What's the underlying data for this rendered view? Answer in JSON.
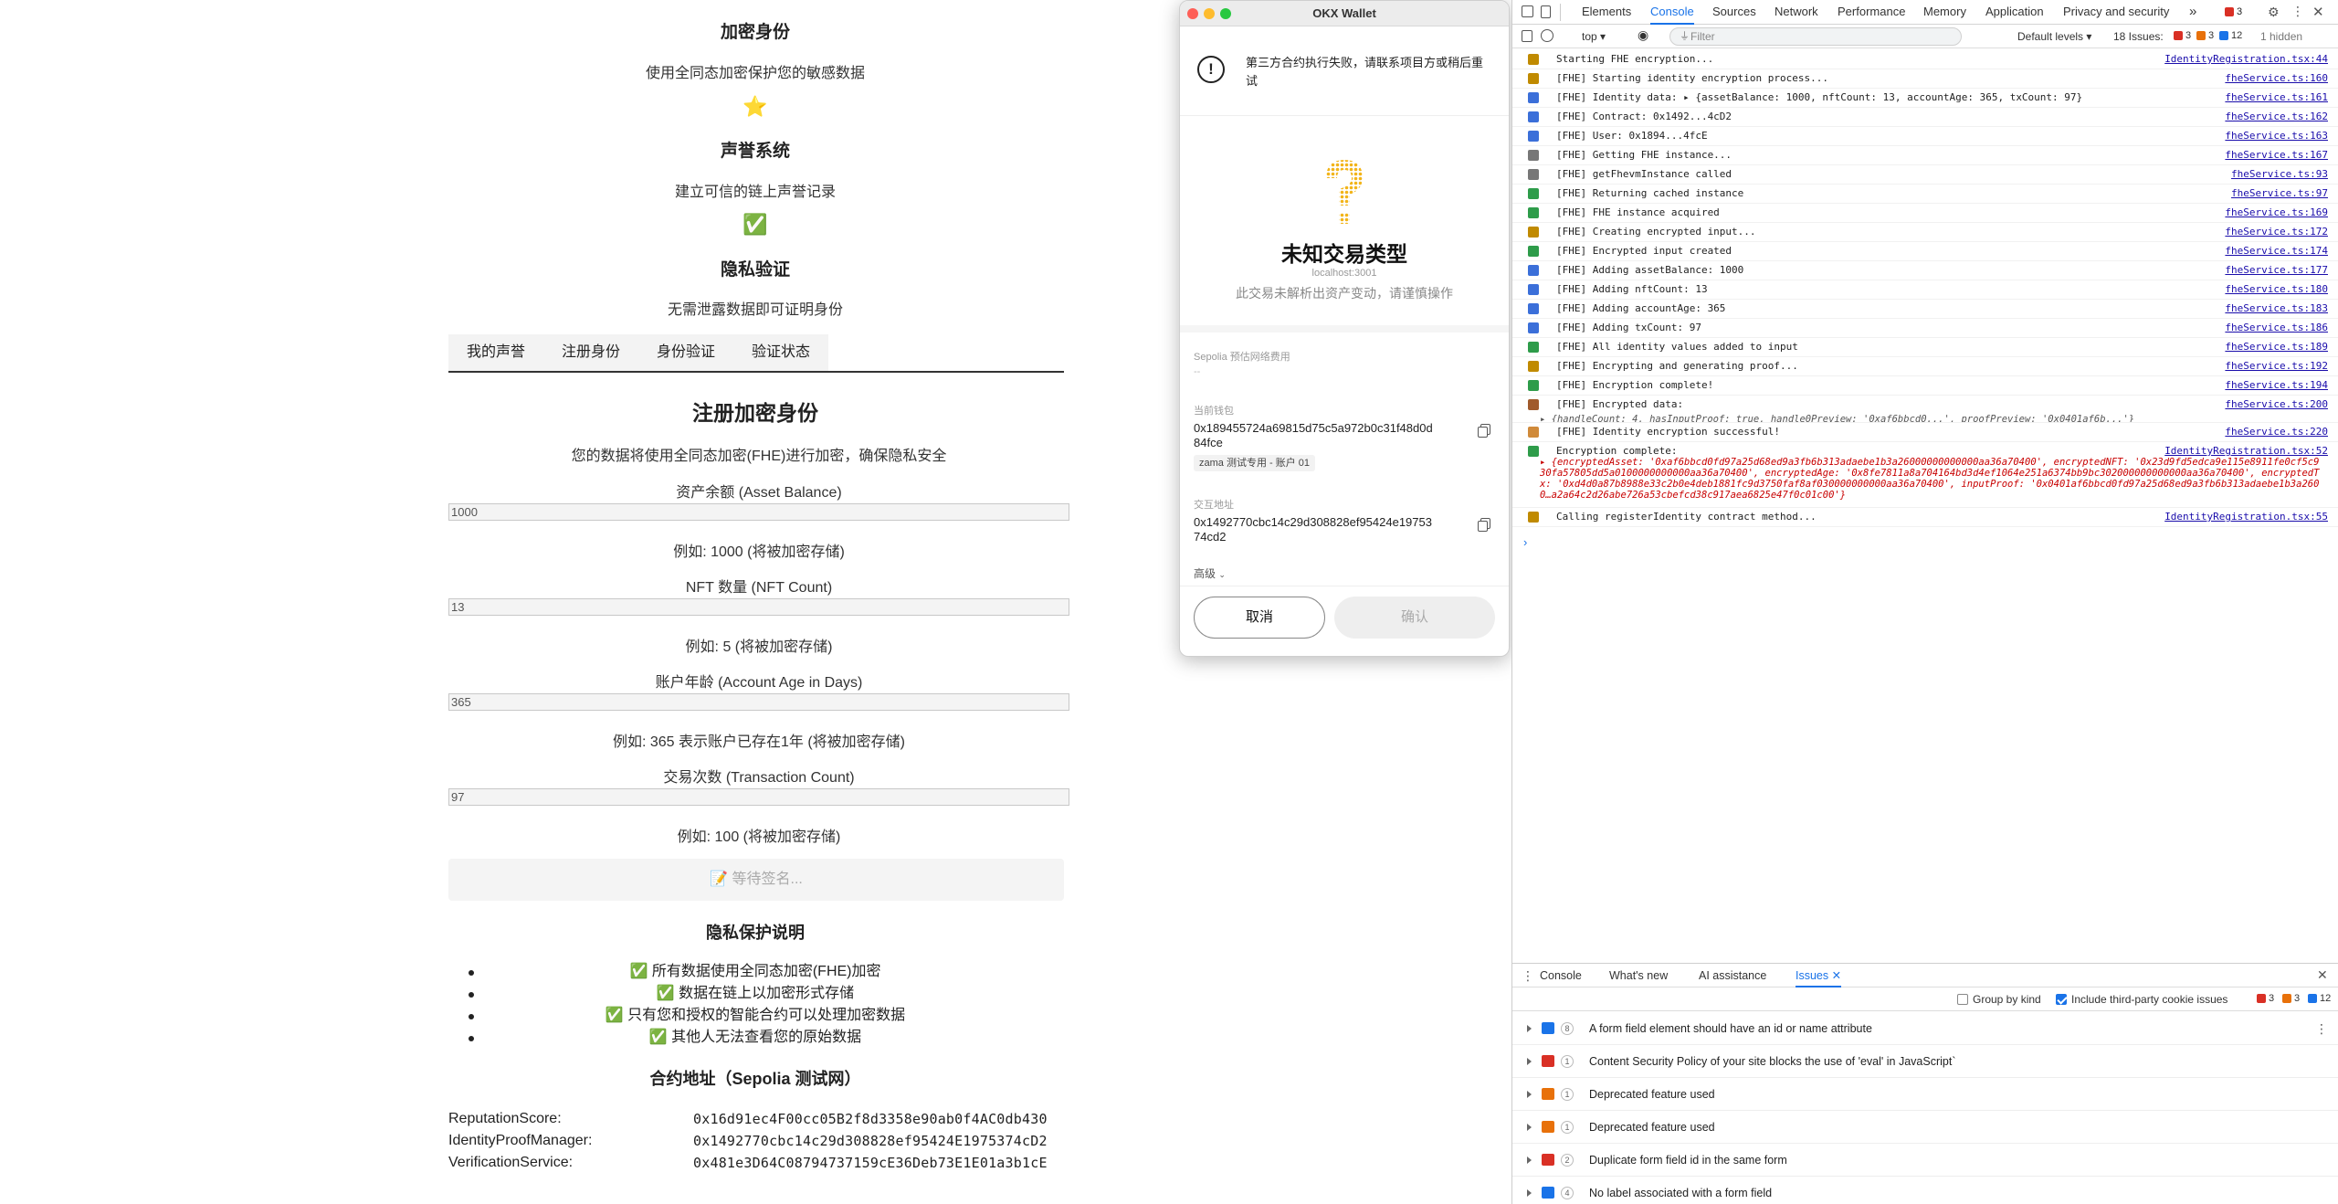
{
  "page": {
    "features": [
      {
        "title": "加密身份",
        "desc": "使用全同态加密保护您的敏感数据"
      },
      {
        "icon": "⭐",
        "title": "声誉系统",
        "desc": "建立可信的链上声誉记录"
      },
      {
        "icon": "✅",
        "title": "隐私验证",
        "desc": "无需泄露数据即可证明身份"
      }
    ],
    "tabs": [
      "我的声誉",
      "注册身份",
      "身份验证",
      "验证状态"
    ],
    "form": {
      "title": "注册加密身份",
      "subtitle": "您的数据将使用全同态加密(FHE)进行加密，确保隐私安全",
      "fields": [
        {
          "label": "资产余额 (Asset Balance)",
          "value": "1000",
          "hint": "例如: 1000 (将被加密存储)"
        },
        {
          "label": "NFT 数量 (NFT Count)",
          "value": "13",
          "hint": "例如: 5 (将被加密存储)"
        },
        {
          "label": "账户年龄 (Account Age in Days)",
          "value": "365",
          "hint": "例如: 365 表示账户已存在1年 (将被加密存储)"
        },
        {
          "label": "交易次数 (Transaction Count)",
          "value": "97",
          "hint": "例如: 100 (将被加密存储)"
        }
      ],
      "submit_label": "📝 等待签名..."
    },
    "privacy": {
      "title": "隐私保护说明",
      "items": [
        "✅ 所有数据使用全同态加密(FHE)加密",
        "✅ 数据在链上以加密形式存储",
        "✅ 只有您和授权的智能合约可以处理加密数据",
        "✅ 其他人无法查看您的原始数据"
      ]
    },
    "contracts": {
      "title": "合约地址（Sepolia 测试网）",
      "rows": [
        {
          "name": "ReputationScore:",
          "addr": "0x16d91ec4F00cc05B2f8d3358e90ab0f4AC0db430"
        },
        {
          "name": "IdentityProofManager:",
          "addr": "0x1492770cbc14c29d308828ef95424E1975374cD2"
        },
        {
          "name": "VerificationService:",
          "addr": "0x481e3D64C08794737159cE36Deb73E1E01a3b1cE"
        }
      ]
    }
  },
  "wallet": {
    "window_title": "OKX Wallet",
    "alert": "第三方合约执行失败，请联系项目方或稍后重试",
    "tx_type": "未知交易类型",
    "site": "localhost:3001",
    "warning": "此交易未解析出资产变动，请谨慎操作",
    "fee_label": "Sepolia 预估网络费用",
    "fee_value": "--",
    "wallet_label": "当前钱包",
    "wallet_addr": "0x189455724a69815d75c5a972b0c31f48d0d84fce",
    "account_tag": "zama 测试专用 - 账户 01",
    "interact_label": "交互地址",
    "interact_addr": "0x1492770cbc14c29d308828ef95424e1975374cd2",
    "advanced": "高级",
    "cancel": "取消",
    "confirm": "确认"
  },
  "devtools": {
    "tabs": [
      "Elements",
      "Console",
      "Sources",
      "Network",
      "Performance",
      "Memory",
      "Application",
      "Privacy and security"
    ],
    "active_tab": "Console",
    "issue_badge": "3",
    "toolbar": {
      "context": "top",
      "filter_placeholder": "Filter",
      "levels": "Default levels",
      "issues_text": "18 Issues:",
      "issue_red": "3",
      "issue_orange": "3",
      "issue_blue": "12",
      "hidden": "1 hidden"
    },
    "logs": [
      {
        "icon": "#c08a00",
        "msg": "Starting FHE encryption...",
        "src": "IdentityRegistration.tsx:44"
      },
      {
        "icon": "#c08a00",
        "msg": "[FHE] Starting identity encryption process...",
        "src": "fheService.ts:160"
      },
      {
        "icon": "#3b6fd9",
        "msg": "[FHE] Identity data:  ▸ {assetBalance: 1000, nftCount: 13, accountAge: 365, txCount: 97}",
        "src": "fheService.ts:161"
      },
      {
        "icon": "#3b6fd9",
        "msg": "[FHE] Contract: 0x1492...4cD2",
        "src": "fheService.ts:162"
      },
      {
        "icon": "#3b6fd9",
        "msg": "[FHE] User: 0x1894...4fcE",
        "src": "fheService.ts:163"
      },
      {
        "icon": "#777777",
        "msg": "[FHE] Getting FHE instance...",
        "src": "fheService.ts:167"
      },
      {
        "icon": "#777777",
        "msg": "[FHE] getFhevmInstance called",
        "src": "fheService.ts:93"
      },
      {
        "icon": "#2e9c4a",
        "msg": "[FHE] Returning cached instance",
        "src": "fheService.ts:97"
      },
      {
        "icon": "#2e9c4a",
        "msg": "[FHE] FHE instance acquired",
        "src": "fheService.ts:169"
      },
      {
        "icon": "#c08a00",
        "msg": "[FHE] Creating encrypted input...",
        "src": "fheService.ts:172"
      },
      {
        "icon": "#2e9c4a",
        "msg": "[FHE] Encrypted input created",
        "src": "fheService.ts:174"
      },
      {
        "icon": "#3b6fd9",
        "msg": "[FHE] Adding assetBalance: 1000",
        "src": "fheService.ts:177"
      },
      {
        "icon": "#3b6fd9",
        "msg": "[FHE] Adding nftCount: 13",
        "src": "fheService.ts:180"
      },
      {
        "icon": "#3b6fd9",
        "msg": "[FHE] Adding accountAge: 365",
        "src": "fheService.ts:183"
      },
      {
        "icon": "#3b6fd9",
        "msg": "[FHE] Adding txCount: 97",
        "src": "fheService.ts:186"
      },
      {
        "icon": "#2e9c4a",
        "msg": "[FHE] All identity values added to input",
        "src": "fheService.ts:189"
      },
      {
        "icon": "#c08a00",
        "msg": "[FHE] Encrypting and generating proof...",
        "src": "fheService.ts:192"
      },
      {
        "icon": "#2e9c4a",
        "msg": "[FHE] Encryption complete!",
        "src": "fheService.ts:194"
      }
    ],
    "encrypted_data": {
      "msg": "[FHE] Encrypted data:",
      "detail": "▸ {handleCount: 4, hasInputProof: true, handle0Preview: '0xaf6bbcd0...', proofPreview: '0x0401af6b...'}",
      "src": "fheService.ts:200"
    },
    "identity_ok": {
      "msg": "[FHE] Identity encryption successful!",
      "src": "fheService.ts:220"
    },
    "enc_complete": {
      "msg": "Encryption complete:",
      "detail": "▸ {encryptedAsset: '0xaf6bbcd0fd97a25d68ed9a3fb6b313adaebe1b3a26000000000000aa36a70400', encryptedNFT: '0x23d9fd5edca9e115e8911fe0cf5c930fa57805dd5a0100000000000aa36a70400', encryptedAge: '0x8fe7811a8a704164bd3d4ef1064e251a6374bb9bc302000000000000aa36a70400', encryptedTx: '0xd4d0a87b8988e33c2b0e4deb1881fc9d3750faf8af030000000000aa36a70400', inputProof: '0x0401af6bbcd0fd97a25d68ed9a3fb6b313adaebe1b3a2600…a2a64c2d26abe726a53cbefcd38c917aea6825e47f0c01c00'}",
      "src": "IdentityRegistration.tsx:52"
    },
    "calling": {
      "msg": "Calling registerIdentity contract method...",
      "src": "IdentityRegistration.tsx:55"
    },
    "prompt": "›",
    "drawer": {
      "tabs": [
        "Console",
        "What's new",
        "AI assistance",
        "Issues"
      ],
      "active": "Issues",
      "group_by_kind": "Group by kind",
      "include_third_party": "Include third-party cookie issues",
      "badge_red": "3",
      "badge_orange": "3",
      "badge_blue": "12",
      "issues": [
        {
          "kind": "#1a73e8",
          "count": "8",
          "text": "A form field element should have an id or name attribute"
        },
        {
          "kind": "#d93025",
          "count": "1",
          "text": "Content Security Policy of your site blocks the use of 'eval' in JavaScript`"
        },
        {
          "kind": "#e8710a",
          "count": "1",
          "text": "Deprecated feature used"
        },
        {
          "kind": "#e8710a",
          "count": "1",
          "text": "Deprecated feature used"
        },
        {
          "kind": "#d93025",
          "count": "2",
          "text": "Duplicate form field id in the same form"
        },
        {
          "kind": "#1a73e8",
          "count": "4",
          "text": "No label associated with a form field"
        }
      ]
    }
  }
}
